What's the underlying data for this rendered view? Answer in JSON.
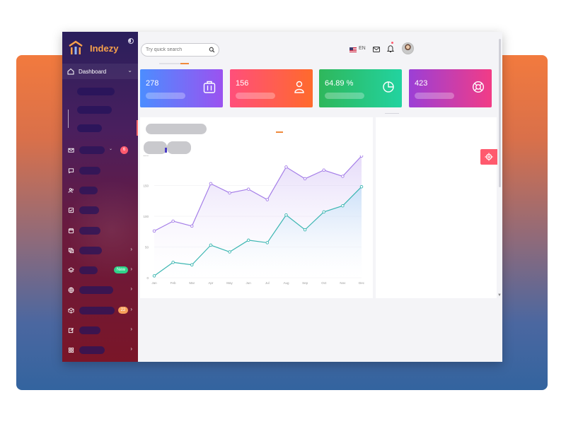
{
  "brand": {
    "name": "Indezy"
  },
  "sidebar": {
    "dashboard_label": "Dashboard",
    "badges": {
      "mail": "6",
      "new": "New",
      "count": "22"
    },
    "icons": [
      "mail-icon",
      "chat-icon",
      "users-icon",
      "checklist-icon",
      "calendar-icon",
      "copy-icon",
      "layers-icon",
      "globe-icon",
      "box-icon",
      "edit-icon",
      "grid-icon"
    ]
  },
  "header": {
    "search_placeholder": "Try quick search",
    "lang": "EN"
  },
  "cards": [
    {
      "value": "278",
      "icon": "briefcase-icon",
      "color_from": "#4c8dff",
      "color_to": "#9b52f0"
    },
    {
      "value": "156",
      "icon": "user-icon",
      "color_from": "#ff4f7b",
      "color_to": "#ff6a2c"
    },
    {
      "value": "64.89 %",
      "icon": "pie-icon",
      "color_from": "#2fb75b",
      "color_to": "#22d3a0"
    },
    {
      "value": "423",
      "icon": "lifebuoy-icon",
      "color_from": "#9b3fd6",
      "color_to": "#f23c86"
    }
  ],
  "chart_data": {
    "type": "line",
    "categories": [
      "Jan",
      "Feb",
      "Mar",
      "Apr",
      "May",
      "Jun",
      "Jul",
      "Aug",
      "Sep",
      "Oct",
      "Nov",
      "Dec"
    ],
    "y_ticks": [
      "200",
      "150",
      "100",
      "50",
      "0"
    ],
    "ylim": [
      0,
      200
    ],
    "series": [
      {
        "values": [
          76,
          92,
          84,
          153,
          138,
          144,
          127,
          180,
          161,
          175,
          165,
          198
        ],
        "color": "#a57ee8"
      },
      {
        "values": [
          3,
          25,
          21,
          53,
          42,
          61,
          57,
          102,
          78,
          107,
          117,
          148
        ],
        "color": "#3bb6b1"
      }
    ]
  }
}
